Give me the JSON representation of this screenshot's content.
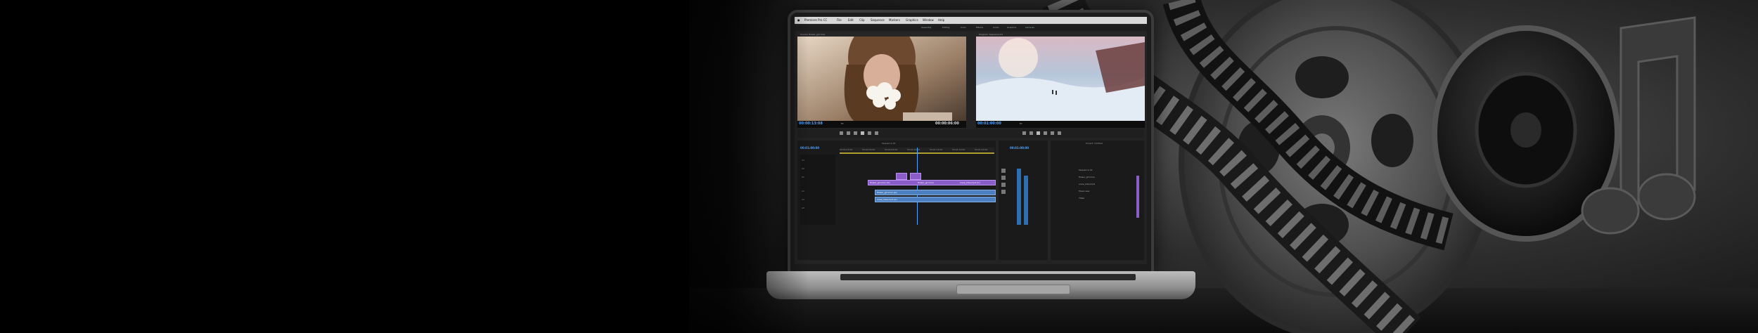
{
  "scene": {
    "menu_items": [
      "",
      "Premiere Pro CC",
      "File",
      "Edit",
      "Clip",
      "Sequence",
      "Markers",
      "Graphics",
      "Window",
      "Help"
    ],
    "workspace_tabs": [
      "Assembly",
      "Editing",
      "Color",
      "Effects",
      "Audio",
      "Graphics",
      "Libraries"
    ],
    "source_monitor": {
      "tab": "Source: flower_girl.mov",
      "timecode_left": "00:00:13:08",
      "timecode_right": "00:00:06:00",
      "fit": "Fit"
    },
    "program_monitor": {
      "tab": "Program: Sequence 01",
      "timecode_left": "00:01:00:00",
      "fit": "Fit"
    },
    "timeline": {
      "tab": "Sequence 01",
      "timecode": "00:01:00:00",
      "ruler": [
        "00:00:15:00",
        "00:00:30:00",
        "00:00:45:00",
        "00:01:00:00",
        "00:01:15:00",
        "00:01:30:00",
        "00:01:45:00"
      ],
      "video_tracks": [
        "V3",
        "V2",
        "V1"
      ],
      "audio_tracks": [
        "A1",
        "A2",
        "A3"
      ],
      "video_clip_labels": [
        "flower_girl.mov [V]",
        "flower_girl.mov",
        "snow_hike.mp4 [V]"
      ],
      "audio_clip_labels": [
        "flower_girl.mov [A]",
        "snow_hike.mp4 [A]"
      ]
    },
    "project_panel": {
      "tab": "Project: Untitled",
      "items": [
        "Sequence 01",
        "flower_girl.mov",
        "snow_hike.mp4",
        "Music.wav",
        "Titles"
      ]
    },
    "colors": {
      "background": "#000000",
      "timecode_blue": "#4aa3ff",
      "video_clip": "#8a5dc9",
      "audio_clip": "#4c7fbf"
    },
    "decor": {
      "film_reel": "film-reel-icon",
      "music_note": "music-note-icon",
      "film_strip": "film-strip"
    }
  }
}
